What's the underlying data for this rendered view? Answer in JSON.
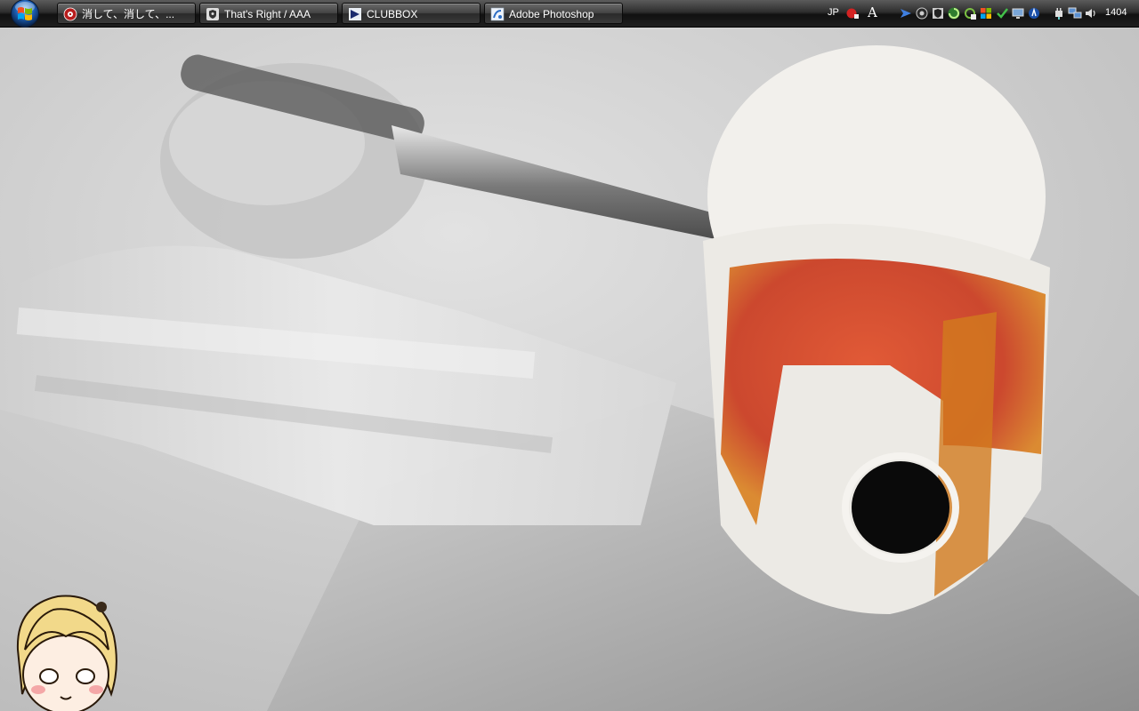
{
  "taskbar": {
    "start_button": {
      "label": "Start"
    },
    "tasks": [
      {
        "label": "消して、消して、...",
        "icon": "music-player-icon"
      },
      {
        "label": "That's Right / AAA",
        "icon": "media-shield-icon"
      },
      {
        "label": "CLUBBOX",
        "icon": "clubbox-arrow-icon"
      },
      {
        "label": "Adobe Photoshop",
        "icon": "photoshop-icon"
      }
    ],
    "tray": {
      "language": "JP",
      "ime_mode": "A",
      "clock": "1404",
      "icons": [
        "ime-pad-icon",
        "send-arrow-icon",
        "network-globe-icon",
        "shield-icon",
        "swirl-app-icon",
        "refresh-icon",
        "windows-flag-icon",
        "checkmark-icon",
        "monitor-icon",
        "antivirus-icon",
        "power-plug-icon",
        "network-monitors-icon",
        "speaker-volume-icon"
      ]
    }
  },
  "desktop": {
    "wallpaper": "masked-figure-with-knife-wallpaper",
    "mascot": "anime-girl-head-icon"
  },
  "colors": {
    "taskbar_top": "#5b5b5b",
    "taskbar_bottom": "#111111",
    "wallpaper_bg": "#d4d4d4",
    "blood_red": "#c8361a",
    "mask_white": "#f2f0ec",
    "hair_blonde": "#f2d98a"
  }
}
